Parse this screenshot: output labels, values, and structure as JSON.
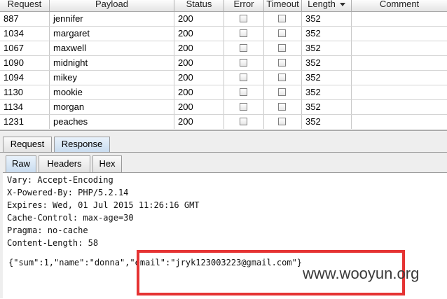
{
  "table": {
    "columns": [
      {
        "key": "request",
        "label": "Request"
      },
      {
        "key": "payload",
        "label": "Payload"
      },
      {
        "key": "status",
        "label": "Status"
      },
      {
        "key": "error",
        "label": "Error"
      },
      {
        "key": "timeout",
        "label": "Timeout"
      },
      {
        "key": "length",
        "label": "Length",
        "sorted": "desc"
      },
      {
        "key": "comment",
        "label": "Comment"
      }
    ],
    "rows": [
      {
        "request": "887",
        "payload": "jennifer",
        "status": "200",
        "error": false,
        "timeout": false,
        "length": "352",
        "comment": ""
      },
      {
        "request": "1034",
        "payload": "margaret",
        "status": "200",
        "error": false,
        "timeout": false,
        "length": "352",
        "comment": ""
      },
      {
        "request": "1067",
        "payload": "maxwell",
        "status": "200",
        "error": false,
        "timeout": false,
        "length": "352",
        "comment": ""
      },
      {
        "request": "1090",
        "payload": "midnight",
        "status": "200",
        "error": false,
        "timeout": false,
        "length": "352",
        "comment": ""
      },
      {
        "request": "1094",
        "payload": "mikey",
        "status": "200",
        "error": false,
        "timeout": false,
        "length": "352",
        "comment": ""
      },
      {
        "request": "1130",
        "payload": "mookie",
        "status": "200",
        "error": false,
        "timeout": false,
        "length": "352",
        "comment": ""
      },
      {
        "request": "1134",
        "payload": "morgan",
        "status": "200",
        "error": false,
        "timeout": false,
        "length": "352",
        "comment": ""
      },
      {
        "request": "1231",
        "payload": "peaches",
        "status": "200",
        "error": false,
        "timeout": false,
        "length": "352",
        "comment": ""
      }
    ]
  },
  "tabs": {
    "request": "Request",
    "response": "Response",
    "active": "response"
  },
  "subtabs": {
    "raw": "Raw",
    "headers": "Headers",
    "hex": "Hex",
    "active": "raw"
  },
  "response": {
    "lines": [
      "Vary: Accept-Encoding",
      "X-Powered-By: PHP/5.2.14",
      "Expires: Wed, 01 Jul 2015 11:26:16 GMT",
      "Cache-Control: max-age=30",
      "Pragma: no-cache",
      "Content-Length: 58"
    ],
    "body": "{\"sum\":1,\"name\":\"donna\",\"email\":\"jryk123003223@gmail.com\"}"
  },
  "watermark": "www.wooyun.org",
  "colors": {
    "highlight_box": "#e53333",
    "active_tab": "#c9dcef"
  }
}
